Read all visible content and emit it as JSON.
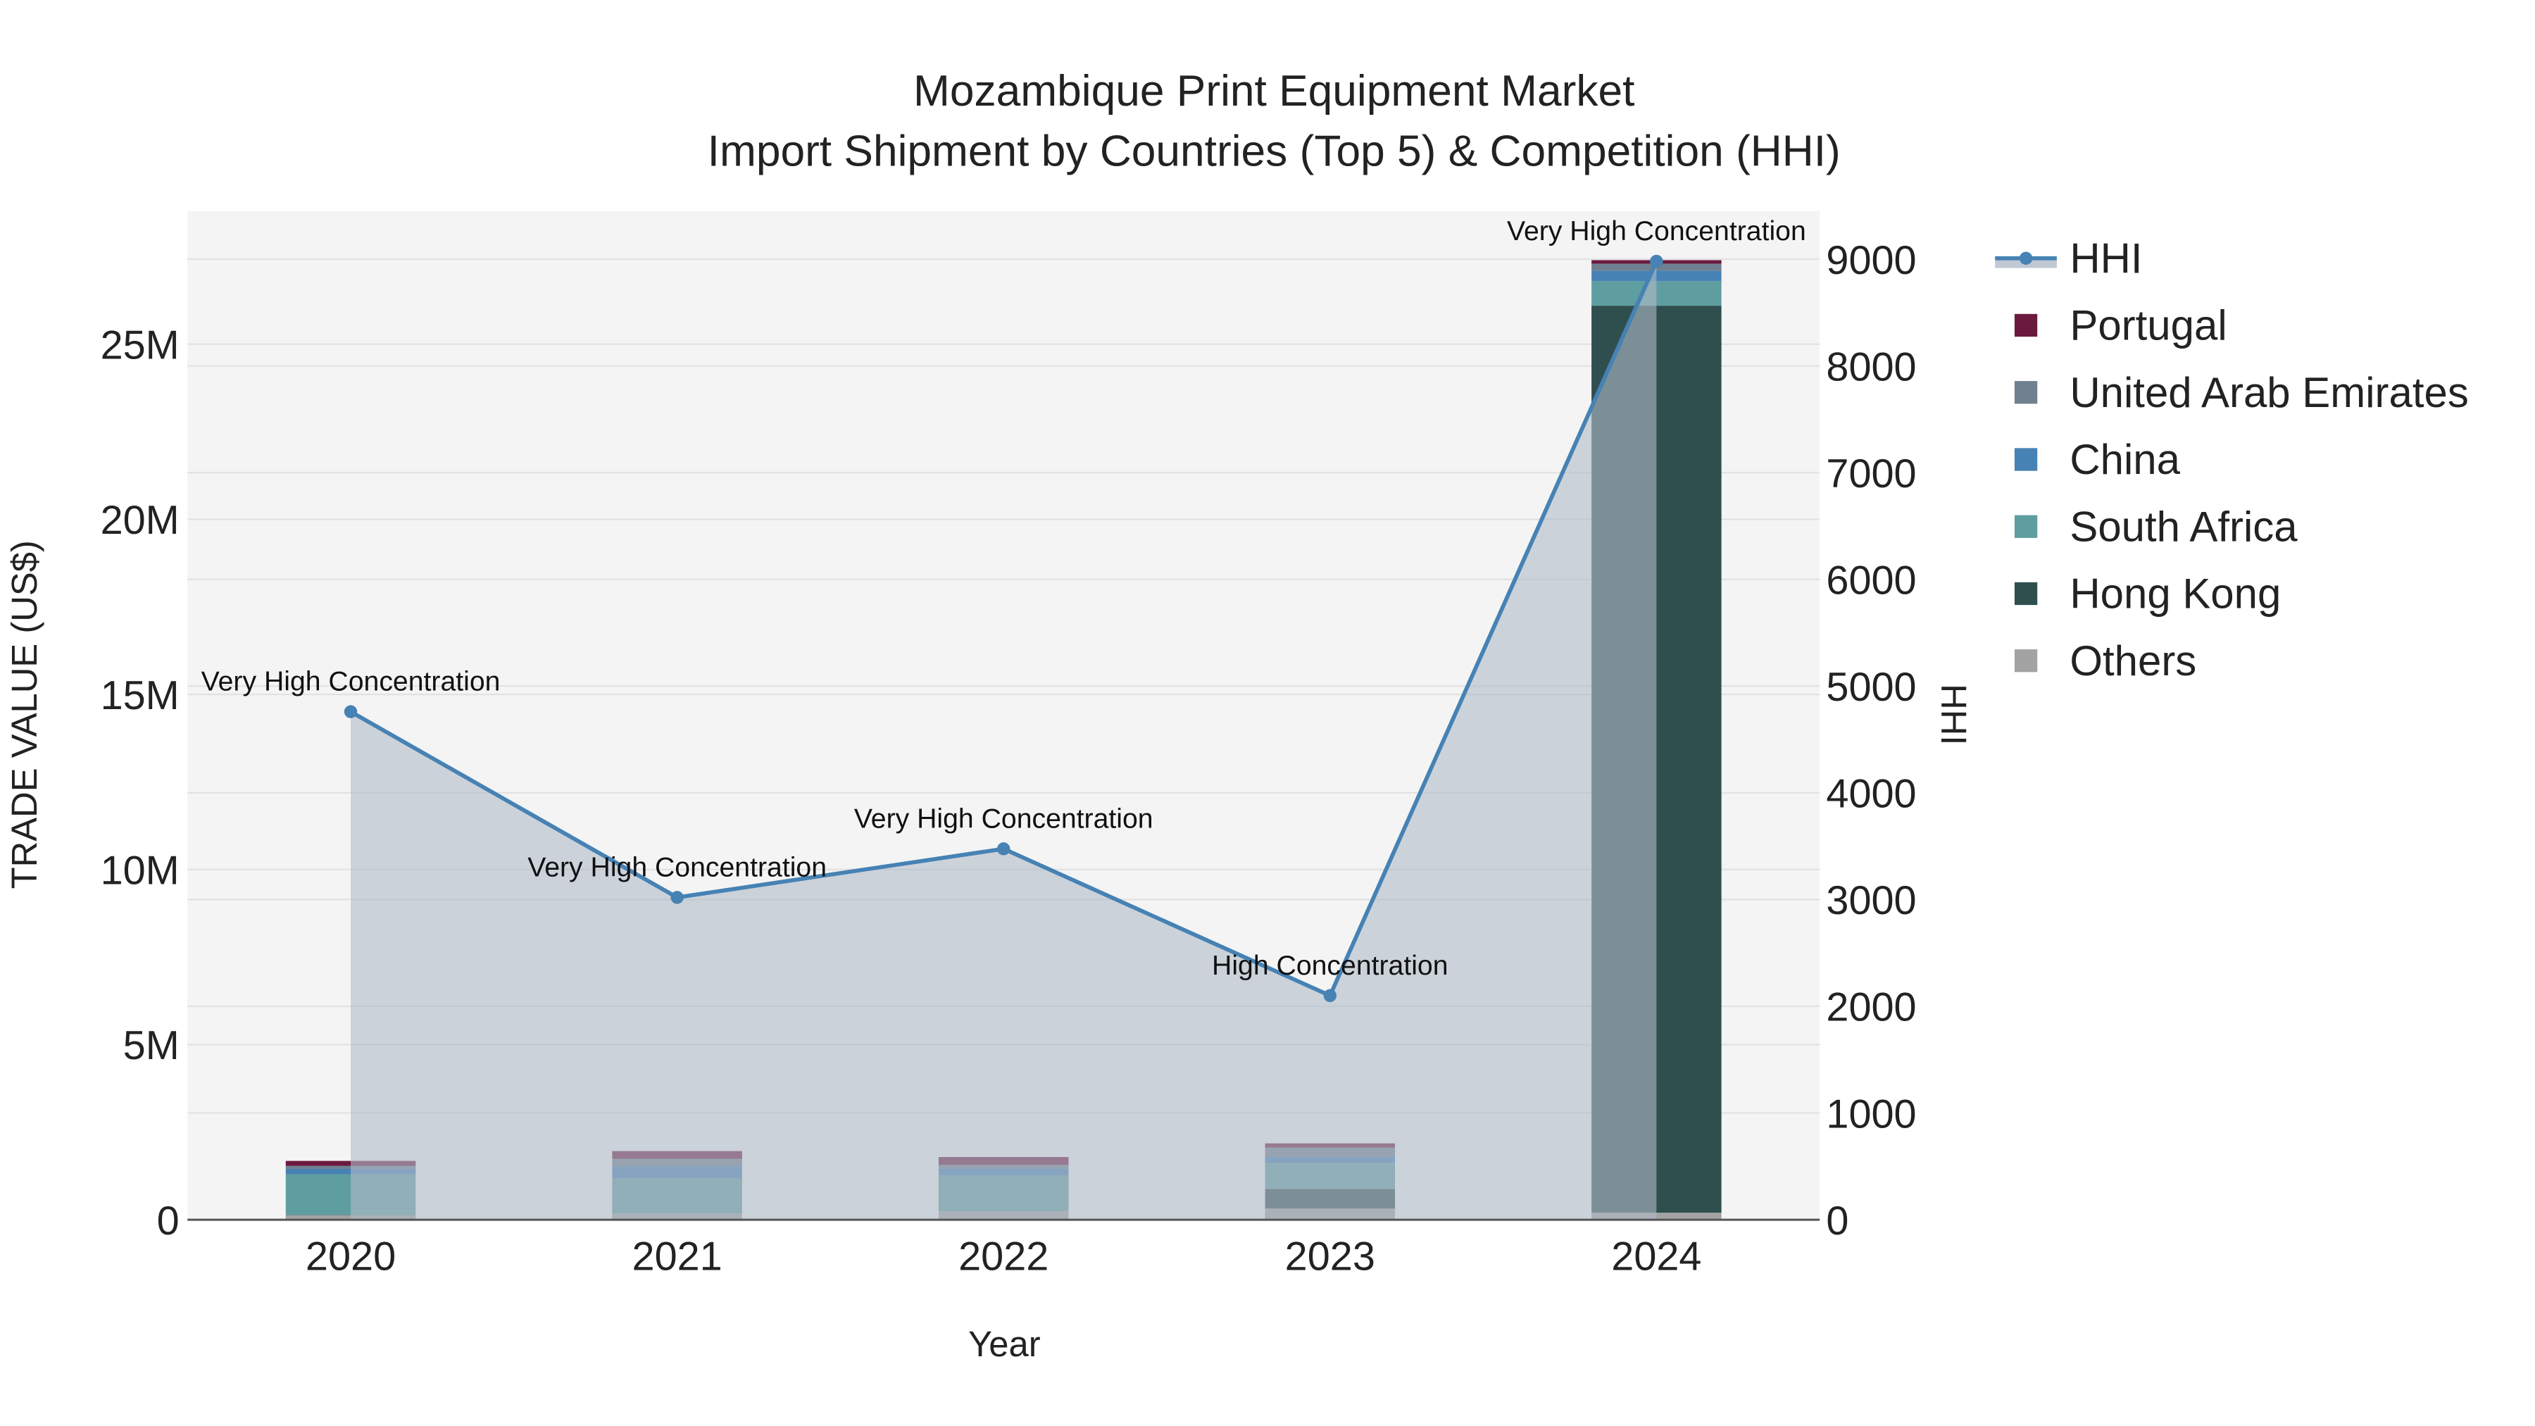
{
  "chart_data": {
    "type": "bar",
    "title": "Mozambique Print Equipment Market",
    "subtitle": "Import Shipment by Countries (Top 5) & Competition (HHI)",
    "xlabel": "Year",
    "ylabel": "TRADE VALUE (US$)",
    "y2label": "HHI",
    "categories": [
      "2020",
      "2021",
      "2022",
      "2023",
      "2024"
    ],
    "ylim": [
      0,
      28800000
    ],
    "y_ticks": [
      0,
      5000000,
      10000000,
      15000000,
      20000000,
      25000000
    ],
    "y_tick_labels": [
      "0",
      "5M",
      "10M",
      "15M",
      "20M",
      "25M"
    ],
    "y2lim": [
      0,
      9450
    ],
    "y2_ticks": [
      0,
      1000,
      2000,
      3000,
      4000,
      5000,
      6000,
      7000,
      8000,
      9000
    ],
    "y2_tick_labels": [
      "0",
      "1000",
      "2000",
      "3000",
      "4000",
      "5000",
      "6000",
      "7000",
      "8000",
      "9000"
    ],
    "grid": true,
    "legend_position": "right",
    "series": [
      {
        "name": "Others",
        "color": "#a3a3a3",
        "values": [
          130000,
          180000,
          240000,
          320000,
          200000
        ]
      },
      {
        "name": "Hong Kong",
        "color": "#2f4f4f",
        "values": [
          10000,
          0,
          0,
          560000,
          25900000
        ]
      },
      {
        "name": "South Africa",
        "color": "#5f9ea0",
        "values": [
          1160000,
          1000000,
          1030000,
          750000,
          700000
        ]
      },
      {
        "name": "China",
        "color": "#4682b4",
        "values": [
          150000,
          340000,
          190000,
          170000,
          300000
        ]
      },
      {
        "name": "United Arab Emirates",
        "color": "#708090",
        "values": [
          90000,
          220000,
          110000,
          260000,
          200000
        ]
      },
      {
        "name": "Portugal",
        "color": "#6b1a3f",
        "values": [
          140000,
          220000,
          220000,
          120000,
          100000
        ]
      }
    ],
    "line": {
      "name": "HHI",
      "color": "#4682b4",
      "values": [
        4760,
        3020,
        3475,
        2100,
        8980
      ],
      "annotations": [
        "Very High Concentration",
        "Very High Concentration",
        "Very High Concentration",
        "High Concentration",
        "Very High Concentration"
      ]
    },
    "legend_order": [
      "HHI",
      "Portugal",
      "United Arab Emirates",
      "China",
      "South Africa",
      "Hong Kong",
      "Others"
    ]
  }
}
